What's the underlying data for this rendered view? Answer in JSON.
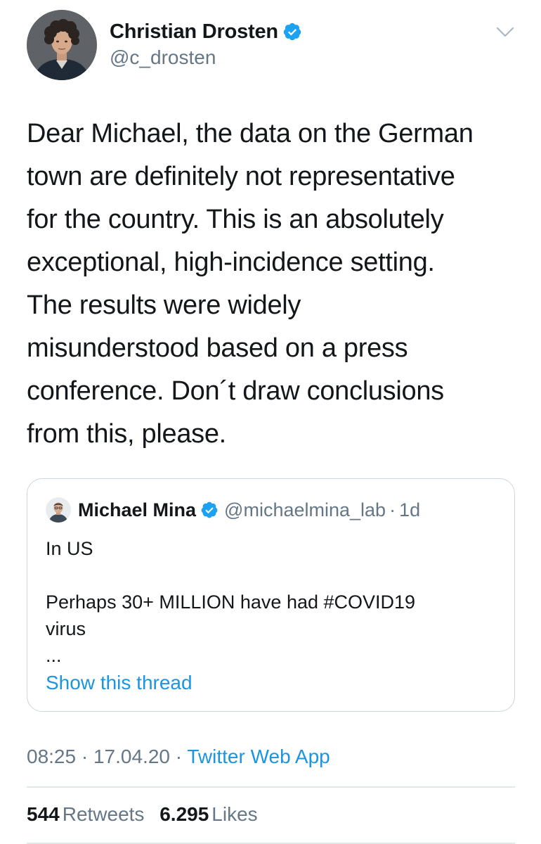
{
  "author": {
    "display_name": "Christian Drosten",
    "handle": "@c_drosten",
    "verified": true
  },
  "tweet": {
    "text_lines": [
      "Dear Michael, the data on the German",
      "town are definitely not representative",
      "for the country. This is an absolutely",
      "exceptional, high-incidence setting.",
      "The results were widely",
      "misunderstood based on a press",
      "conference. Don´t draw conclusions",
      "from this, please."
    ]
  },
  "quoted_tweet": {
    "display_name": "Michael Mina",
    "handle": "@michaelmina_lab",
    "separator": "·",
    "time": "1d",
    "verified": true,
    "body_lines": [
      "In US",
      "",
      "Perhaps 30+ MILLION have had #COVID19",
      "virus",
      "..."
    ],
    "show_thread_label": "Show this thread"
  },
  "meta": {
    "time": "08:25",
    "separator": "·",
    "date": "17.04.20",
    "source": "Twitter Web App"
  },
  "stats": {
    "retweets_count": "544",
    "retweets_label": "Retweets",
    "likes_count": "6.295",
    "likes_label": "Likes"
  },
  "icons": {
    "verified": "verified-badge-icon",
    "chevron": "chevron-down-icon"
  },
  "colors": {
    "link_blue": "#1b95e0",
    "verified_blue": "#1da1f2",
    "secondary_text": "#657786",
    "primary_text": "#14171a",
    "border": "#ccd6dd"
  }
}
